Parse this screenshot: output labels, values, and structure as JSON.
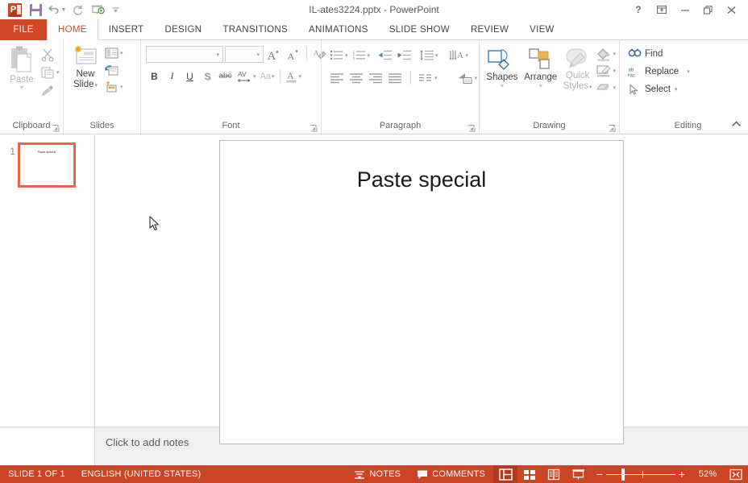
{
  "window": {
    "title": "IL-ates3224.pptx - PowerPoint",
    "accent_color": "#d24726",
    "statusbar_color": "#cb4424",
    "quick_access": [
      {
        "name": "save",
        "label": "Save"
      },
      {
        "name": "undo",
        "label": "Undo"
      },
      {
        "name": "redo",
        "label": "Repeat"
      },
      {
        "name": "start-slideshow",
        "label": "Start From Beginning"
      },
      {
        "name": "customize-qat",
        "label": "Customize Quick Access Toolbar"
      }
    ],
    "controls": [
      {
        "name": "help",
        "label": "?"
      },
      {
        "name": "ribbon-display-options",
        "label": "Ribbon Display Options"
      },
      {
        "name": "minimize",
        "label": "Minimize"
      },
      {
        "name": "restore",
        "label": "Restore Down"
      },
      {
        "name": "close",
        "label": "Close"
      }
    ]
  },
  "tabs": {
    "file": "FILE",
    "items": [
      {
        "label": "HOME",
        "active": true
      },
      {
        "label": "INSERT",
        "active": false
      },
      {
        "label": "DESIGN",
        "active": false
      },
      {
        "label": "TRANSITIONS",
        "active": false
      },
      {
        "label": "ANIMATIONS",
        "active": false
      },
      {
        "label": "SLIDE SHOW",
        "active": false
      },
      {
        "label": "REVIEW",
        "active": false
      },
      {
        "label": "VIEW",
        "active": false
      }
    ]
  },
  "ribbon": {
    "clipboard": {
      "group_label": "Clipboard",
      "paste_label": "Paste",
      "cut_label": "Cut",
      "copy_label": "Copy",
      "format_painter_label": "Format Painter"
    },
    "slides": {
      "group_label": "Slides",
      "new_slide_label": "New\nSlide",
      "new_slide_line1": "New",
      "new_slide_line2": "Slide",
      "layout_label": "Layout",
      "reset_label": "Reset",
      "section_label": "Section"
    },
    "font": {
      "group_label": "Font",
      "font_name_value": "",
      "font_size_value": "",
      "increase_size_label": "A",
      "decrease_size_label": "A",
      "clear_formatting_label": "Clear All Formatting",
      "bold_label": "B",
      "italic_label": "I",
      "underline_label": "U",
      "shadow_label": "S",
      "strikethrough_label": "abc",
      "spacing_label": "AV",
      "change_case_label": "Aa",
      "font_color_label": "A"
    },
    "paragraph": {
      "group_label": "Paragraph",
      "bullets_label": "Bullets",
      "numbering_label": "Numbering",
      "decrease_indent_label": "Decrease List Level",
      "increase_indent_label": "Increase List Level",
      "line_spacing_label": "Line Spacing",
      "text_direction_label": "Text Direction",
      "align_text_label": "Align Text",
      "convert_smartart_label": "Convert to SmartArt",
      "align_left_label": "Align Left",
      "align_center_label": "Center",
      "align_right_label": "Align Right",
      "justify_label": "Justify",
      "columns_label": "Columns"
    },
    "drawing": {
      "group_label": "Drawing",
      "shapes_label": "Shapes",
      "arrange_label": "Arrange",
      "quick_styles_line1": "Quick",
      "quick_styles_line2": "Styles",
      "shape_fill_label": "Shape Fill",
      "shape_outline_label": "Shape Outline",
      "shape_effects_label": "Shape Effects"
    },
    "editing": {
      "group_label": "Editing",
      "find_label": "Find",
      "replace_label": "Replace",
      "select_label": "Select",
      "collapse_label": "Collapse the Ribbon"
    }
  },
  "thumbnails": [
    {
      "number": "1",
      "title": "Paste special",
      "selected": true
    }
  ],
  "slide": {
    "title": "Paste special"
  },
  "notes": {
    "placeholder": "Click to add notes"
  },
  "status": {
    "slide_indicator": "SLIDE 1 OF 1",
    "language": "ENGLISH (UNITED STATES)",
    "notes_label": "NOTES",
    "comments_label": "COMMENTS",
    "views": [
      {
        "name": "normal-view",
        "label": "Normal",
        "active": true
      },
      {
        "name": "slide-sorter-view",
        "label": "Slide Sorter",
        "active": false
      },
      {
        "name": "reading-view",
        "label": "Reading View",
        "active": false
      },
      {
        "name": "slide-show-view",
        "label": "Slide Show",
        "active": false
      }
    ],
    "zoom_out_label": "−",
    "zoom_in_label": "+",
    "zoom_percent": "52%",
    "fit_label": "Fit slide to current window"
  }
}
